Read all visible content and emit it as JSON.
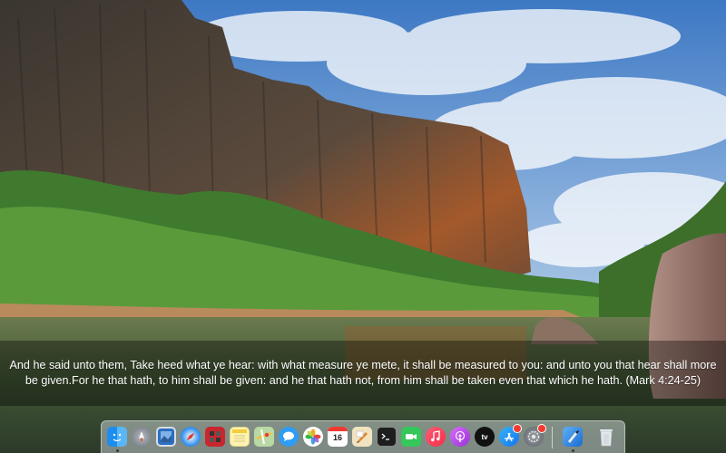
{
  "verse": {
    "text": "And he said unto them, Take heed what ye hear: with what measure ye mete, it shall be measured to you: and unto you that hear shall more be given.For he that hath, to him shall be given: and he that hath not, from him shall be taken even that which he hath. (Mark 4:24-25)"
  },
  "calendar": {
    "date": "16"
  },
  "appletv": {
    "label": "tv"
  },
  "dock": {
    "apps": [
      {
        "name": "finder-icon",
        "running": true
      },
      {
        "name": "launchpad-icon",
        "running": false
      },
      {
        "name": "preview-icon",
        "running": false
      },
      {
        "name": "safari-icon",
        "running": false
      },
      {
        "name": "photo-booth-icon",
        "running": false
      },
      {
        "name": "notes-icon",
        "running": false
      },
      {
        "name": "maps-icon",
        "running": false
      },
      {
        "name": "messages-icon",
        "running": false
      },
      {
        "name": "photos-icon",
        "running": false
      },
      {
        "name": "calendar-icon",
        "running": false
      },
      {
        "name": "sketch-icon",
        "running": false
      },
      {
        "name": "terminal-icon",
        "running": false
      },
      {
        "name": "facetime-icon",
        "running": false
      },
      {
        "name": "music-icon",
        "running": false
      },
      {
        "name": "podcasts-icon",
        "running": false
      },
      {
        "name": "apple-tv-icon",
        "running": false
      },
      {
        "name": "app-store-icon",
        "running": false,
        "badge": true
      },
      {
        "name": "system-preferences-icon",
        "running": false,
        "badge": true
      },
      {
        "name": "xcode-icon",
        "running": true
      },
      {
        "name": "trash-icon",
        "running": false
      }
    ]
  }
}
